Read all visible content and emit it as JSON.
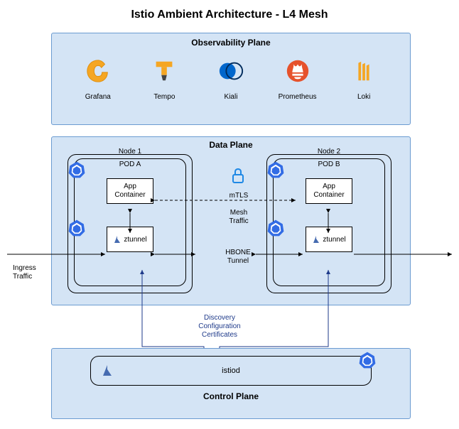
{
  "title": "Istio Ambient Architecture - L4 Mesh",
  "observability": {
    "title": "Observability Plane",
    "items": [
      {
        "label": "Grafana",
        "icon": "grafana"
      },
      {
        "label": "Tempo",
        "icon": "tempo"
      },
      {
        "label": "Kiali",
        "icon": "kiali"
      },
      {
        "label": "Prometheus",
        "icon": "prometheus"
      },
      {
        "label": "Loki",
        "icon": "loki"
      }
    ]
  },
  "data_plane": {
    "title": "Data Plane",
    "nodes": [
      {
        "name": "Node 1",
        "pod": {
          "name": "POD A",
          "app": "App\nContainer",
          "ztunnel": "ztunnel"
        }
      },
      {
        "name": "Node 2",
        "pod": {
          "name": "POD B",
          "app": "App\nContainer",
          "ztunnel": "ztunnel"
        }
      }
    ],
    "labels": {
      "mtls": "mTLS",
      "mesh": "Mesh Traffic",
      "hbone": "HBONE Tunnel",
      "ingress": "Ingress Traffic"
    }
  },
  "control_plane": {
    "title": "Control Plane",
    "istiod": "istiod",
    "discovery": "Discovery Configuration Certificates"
  }
}
